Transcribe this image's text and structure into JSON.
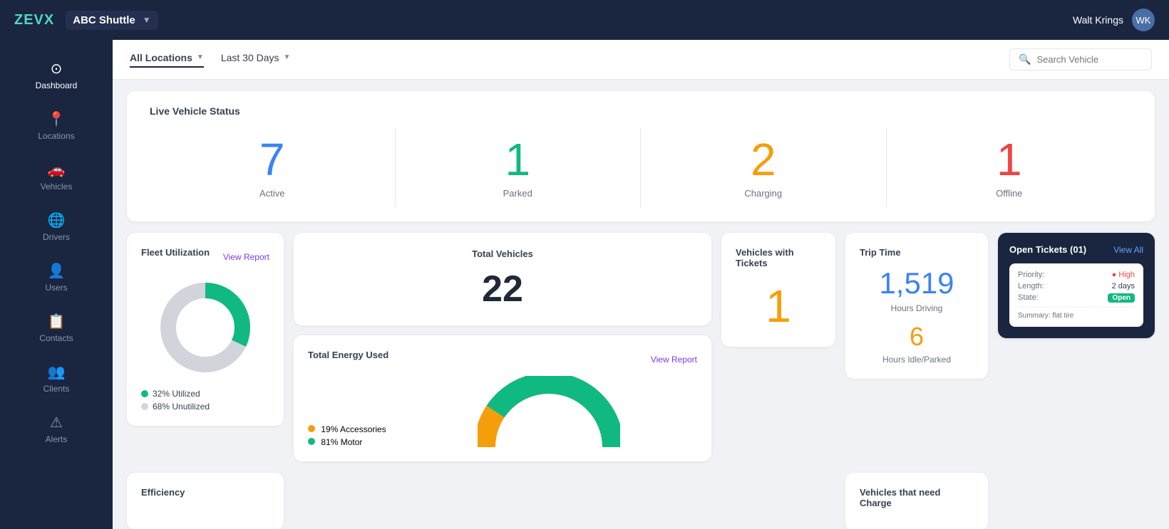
{
  "app": {
    "logo_z": "ZEV",
    "logo_x": "X",
    "org_name": "ABC Shuttle",
    "user_name": "Walt Krings"
  },
  "sidebar": {
    "items": [
      {
        "id": "dashboard",
        "label": "Dashboard",
        "icon": "⊙"
      },
      {
        "id": "locations",
        "label": "Locations",
        "icon": "📍"
      },
      {
        "id": "vehicles",
        "label": "Vehicles",
        "icon": "🚗"
      },
      {
        "id": "drivers",
        "label": "Drivers",
        "icon": "🌐"
      },
      {
        "id": "users",
        "label": "Users",
        "icon": "👤"
      },
      {
        "id": "contacts",
        "label": "Contacts",
        "icon": "📋"
      },
      {
        "id": "clients",
        "label": "Clients",
        "icon": "👥"
      },
      {
        "id": "alerts",
        "label": "Alerts",
        "icon": "⚠"
      }
    ]
  },
  "filterbar": {
    "location_filter": "All Locations",
    "date_filter": "Last 30 Days",
    "search_placeholder": "Search Vehicle"
  },
  "live_status": {
    "title": "Live Vehicle Status",
    "active": {
      "value": "7",
      "label": "Active"
    },
    "parked": {
      "value": "1",
      "label": "Parked"
    },
    "charging": {
      "value": "2",
      "label": "Charging"
    },
    "offline": {
      "value": "1",
      "label": "Offline"
    }
  },
  "fleet_utilization": {
    "title": "Fleet Utilization",
    "link": "View Report",
    "utilized_pct": 32,
    "unutilized_pct": 68,
    "utilized_label": "32% Utilized",
    "unutilized_label": "68% Unutilized"
  },
  "total_vehicles": {
    "title": "Total Vehicles",
    "value": "22"
  },
  "vehicles_with_tickets": {
    "title": "Vehicles with Tickets",
    "value": "1"
  },
  "trip_time": {
    "title": "Trip Time",
    "hours_driving": "1,519",
    "hours_driving_label": "Hours Driving",
    "hours_idle": "6",
    "hours_idle_label": "Hours Idle/Parked"
  },
  "open_tickets": {
    "title": "Open Tickets (01)",
    "view_all": "View All",
    "ticket": {
      "priority_label": "Priority:",
      "priority_value": "High",
      "length_label": "Length:",
      "length_value": "2 days",
      "state_label": "State:",
      "state_value": "Open",
      "summary_label": "Summary: flat tire"
    }
  },
  "total_energy": {
    "title": "Total Energy Used",
    "link": "View Report",
    "accessories_pct": "19% Accessories",
    "motor_pct": "81% Motor"
  },
  "efficiency": {
    "title": "Efficiency"
  },
  "vehicles_need_charge": {
    "title": "Vehicles that need Charge"
  }
}
